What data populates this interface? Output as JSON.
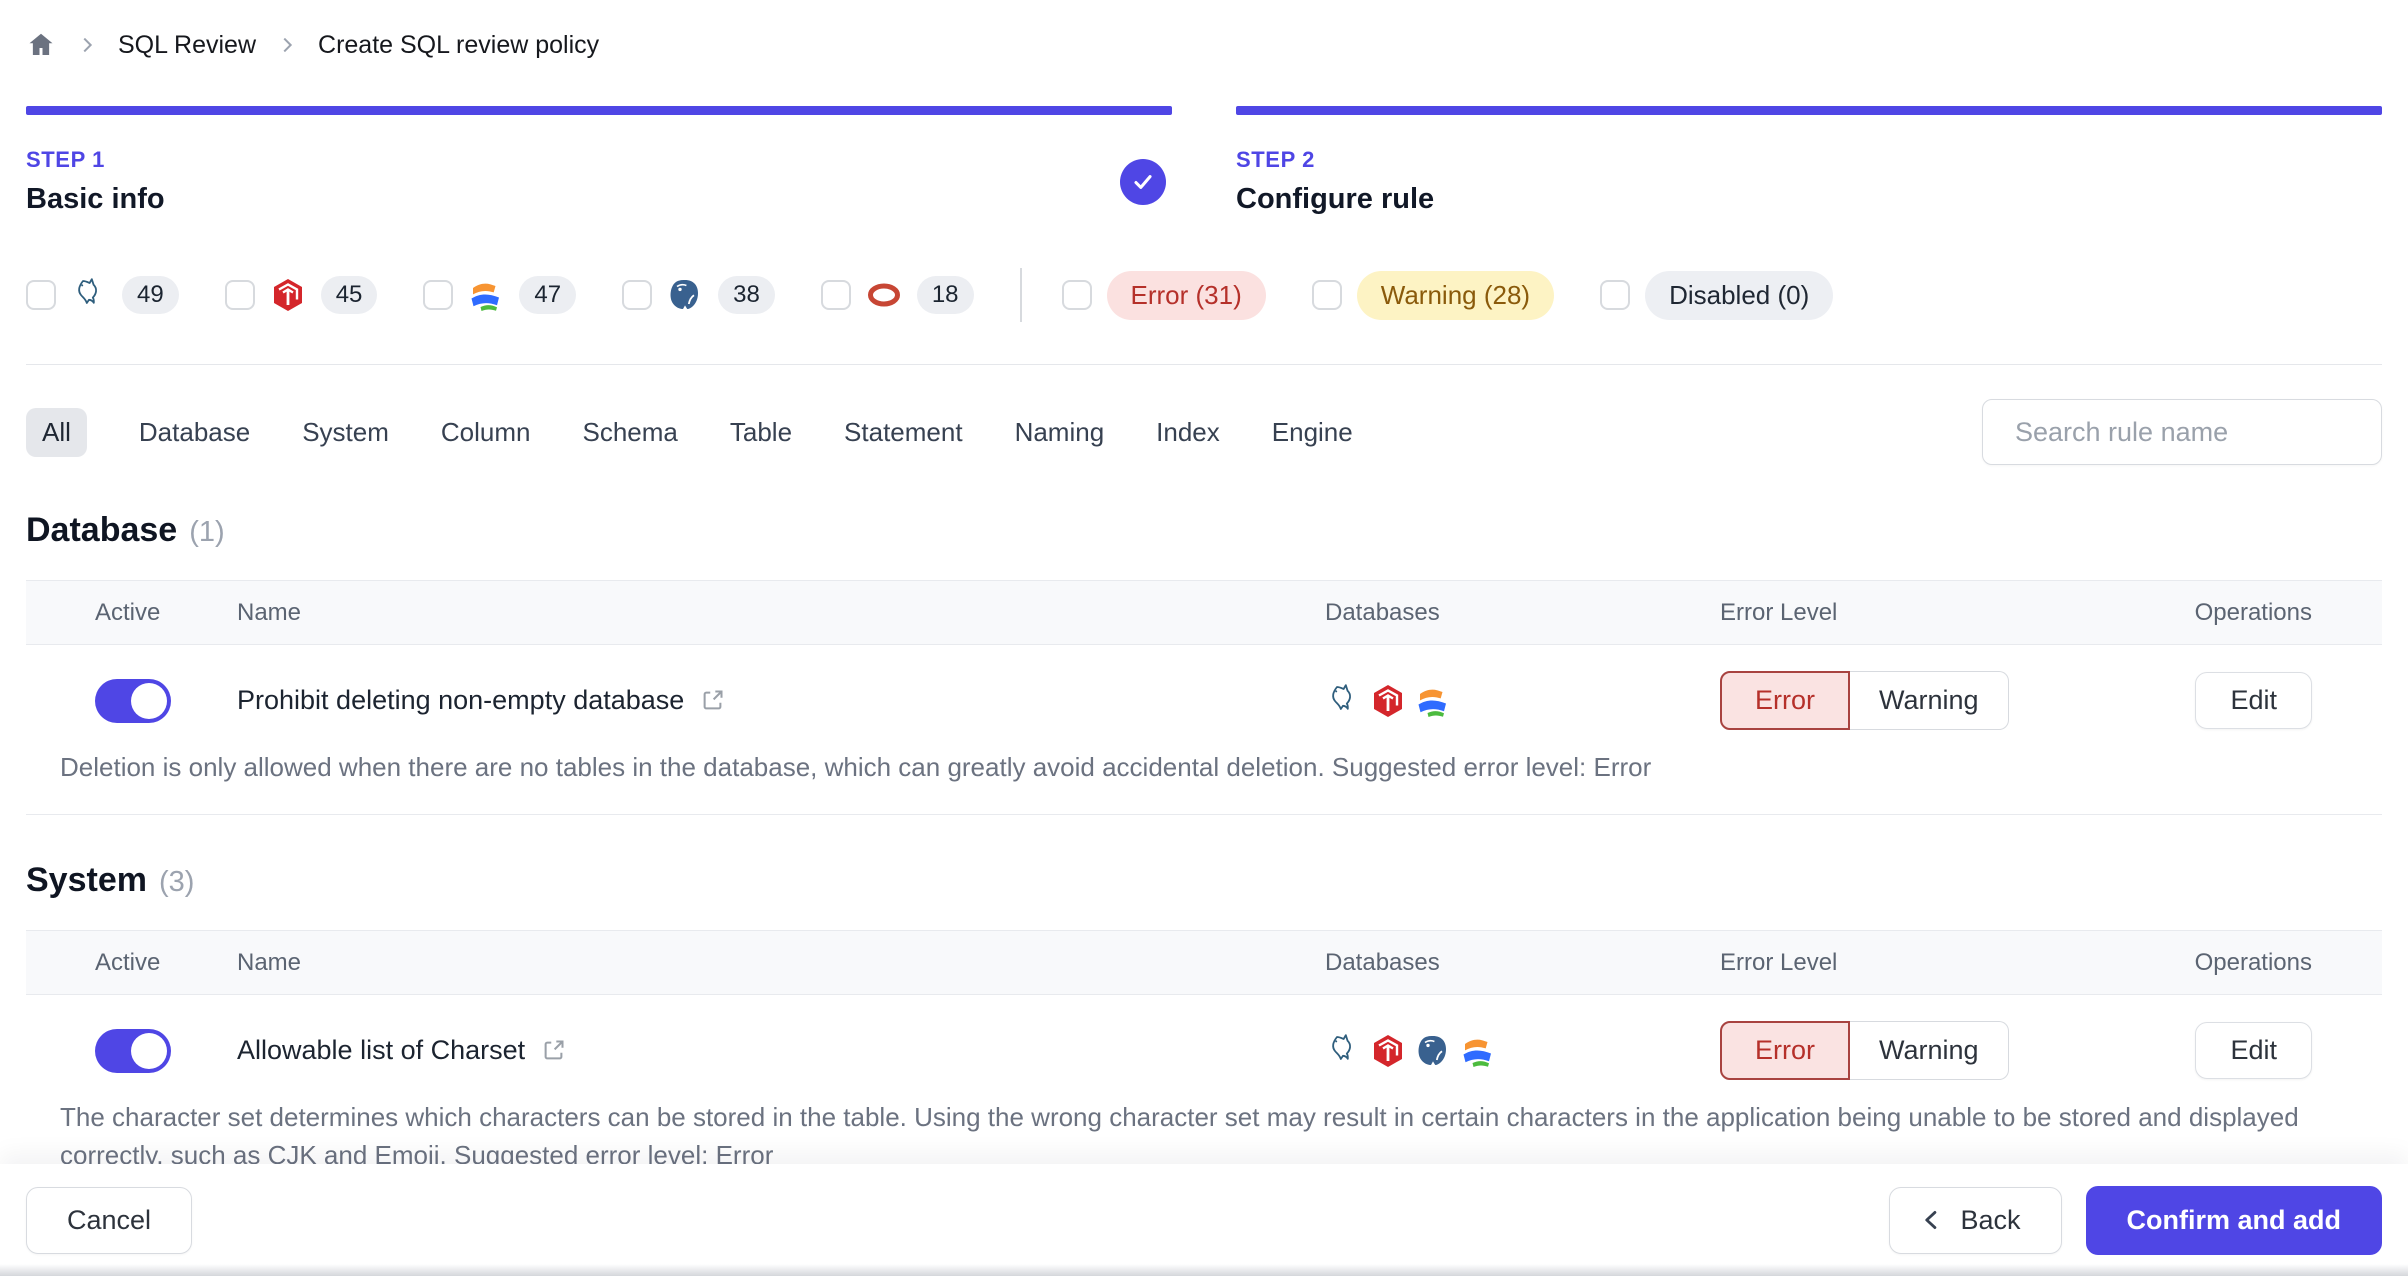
{
  "breadcrumb": {
    "items": [
      "SQL Review",
      "Create SQL review policy"
    ]
  },
  "steps": [
    {
      "label": "STEP 1",
      "name": "Basic info",
      "completed": true
    },
    {
      "label": "STEP 2",
      "name": "Configure rule",
      "completed": false
    }
  ],
  "filters": {
    "engines": [
      {
        "name": "mysql",
        "count": 49,
        "checked": false
      },
      {
        "name": "tidb",
        "count": 45,
        "checked": false
      },
      {
        "name": "oceanbase",
        "count": 47,
        "checked": false
      },
      {
        "name": "postgres",
        "count": 38,
        "checked": false
      },
      {
        "name": "oracle",
        "count": 18,
        "checked": false
      }
    ],
    "levels": [
      {
        "label": "Error (31)",
        "type": "error",
        "checked": false
      },
      {
        "label": "Warning (28)",
        "type": "warning",
        "checked": false
      },
      {
        "label": "Disabled (0)",
        "type": "disabled",
        "checked": false
      }
    ]
  },
  "tabs": {
    "items": [
      "All",
      "Database",
      "System",
      "Column",
      "Schema",
      "Table",
      "Statement",
      "Naming",
      "Index",
      "Engine"
    ],
    "active": "All"
  },
  "search": {
    "placeholder": "Search rule name"
  },
  "table_headers": [
    "Active",
    "Name",
    "Databases",
    "Error Level",
    "Operations"
  ],
  "sections": [
    {
      "title": "Database",
      "count": "(1)",
      "rules": [
        {
          "name": "Prohibit deleting non-empty database",
          "active": true,
          "engines": [
            "mysql",
            "tidb",
            "oceanbase"
          ],
          "level": "Error",
          "level_options": [
            "Error",
            "Warning"
          ],
          "operation": "Edit",
          "description": "Deletion is only allowed when there are no tables in the database, which can greatly avoid accidental deletion. Suggested error level: Error"
        }
      ]
    },
    {
      "title": "System",
      "count": "(3)",
      "rules": [
        {
          "name": "Allowable list of Charset",
          "active": true,
          "engines": [
            "mysql",
            "tidb",
            "postgres",
            "oceanbase"
          ],
          "level": "Error",
          "level_options": [
            "Error",
            "Warning"
          ],
          "operation": "Edit",
          "description": "The character set determines which characters can be stored in the table. Using the wrong character set may result in certain characters in the application being unable to be stored and displayed correctly, such as CJK and Emoji. Suggested error level: Error"
        }
      ]
    }
  ],
  "footer": {
    "cancel_label": "Cancel",
    "back_label": "Back",
    "confirm_label": "Confirm and add"
  },
  "colors": {
    "accent": "#4f46e5",
    "error_text": "#b5302a",
    "error_bg": "#fbe1e0",
    "error_border": "#a84340",
    "warning_text": "#8a5a0b",
    "warning_bg": "#fdf3c4",
    "disabled_bg": "#edeff3"
  }
}
